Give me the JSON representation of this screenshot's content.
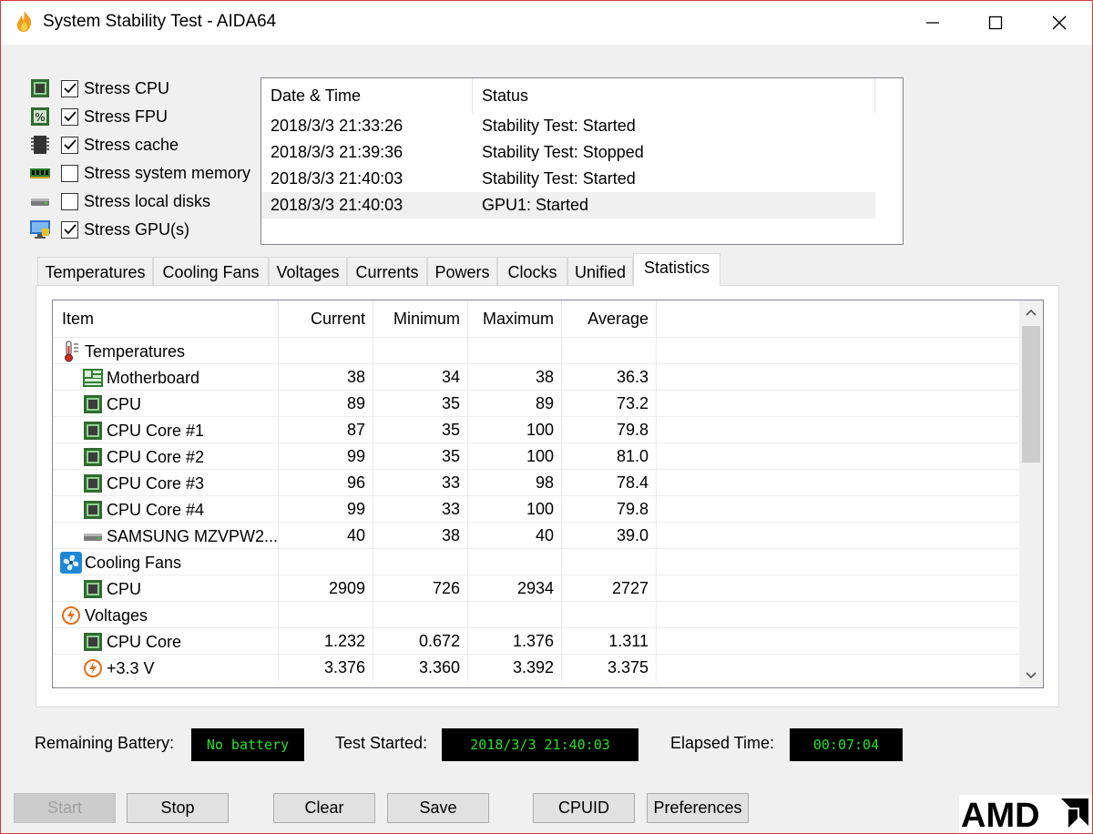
{
  "window": {
    "title": "System Stability Test - AIDA64"
  },
  "stress": [
    {
      "label": "Stress CPU",
      "checked": true,
      "icon": "cpu-chip-icon"
    },
    {
      "label": "Stress FPU",
      "checked": true,
      "icon": "fpu-percent-icon"
    },
    {
      "label": "Stress cache",
      "checked": true,
      "icon": "cache-chip-icon"
    },
    {
      "label": "Stress system memory",
      "checked": false,
      "icon": "memory-module-icon"
    },
    {
      "label": "Stress local disks",
      "checked": false,
      "icon": "disk-drive-icon"
    },
    {
      "label": "Stress GPU(s)",
      "checked": true,
      "icon": "gpu-monitor-icon"
    }
  ],
  "log": {
    "headers": [
      "Date & Time",
      "Status"
    ],
    "rows": [
      {
        "time": "2018/3/3 21:33:26",
        "status": "Stability Test: Started"
      },
      {
        "time": "2018/3/3 21:39:36",
        "status": "Stability Test: Stopped"
      },
      {
        "time": "2018/3/3 21:40:03",
        "status": "Stability Test: Started"
      },
      {
        "time": "2018/3/3 21:40:03",
        "status": "GPU1: Started"
      }
    ]
  },
  "tabs": [
    "Temperatures",
    "Cooling Fans",
    "Voltages",
    "Currents",
    "Powers",
    "Clocks",
    "Unified",
    "Statistics"
  ],
  "active_tab": "Statistics",
  "stats": {
    "headers": [
      "Item",
      "Current",
      "Minimum",
      "Maximum",
      "Average"
    ],
    "rows": [
      {
        "name": "Temperatures",
        "icon": "thermometer-icon",
        "level": 0,
        "cur": "",
        "min": "",
        "max": "",
        "avg": ""
      },
      {
        "name": "Motherboard",
        "icon": "motherboard-icon",
        "level": 1,
        "cur": "38",
        "min": "34",
        "max": "38",
        "avg": "36.3"
      },
      {
        "name": "CPU",
        "icon": "cpu-chip-icon",
        "level": 1,
        "cur": "89",
        "min": "35",
        "max": "89",
        "avg": "73.2"
      },
      {
        "name": "CPU Core #1",
        "icon": "cpu-chip-icon",
        "level": 1,
        "cur": "87",
        "min": "35",
        "max": "100",
        "avg": "79.8"
      },
      {
        "name": "CPU Core #2",
        "icon": "cpu-chip-icon",
        "level": 1,
        "cur": "99",
        "min": "35",
        "max": "100",
        "avg": "81.0"
      },
      {
        "name": "CPU Core #3",
        "icon": "cpu-chip-icon",
        "level": 1,
        "cur": "96",
        "min": "33",
        "max": "98",
        "avg": "78.4"
      },
      {
        "name": "CPU Core #4",
        "icon": "cpu-chip-icon",
        "level": 1,
        "cur": "99",
        "min": "33",
        "max": "100",
        "avg": "79.8"
      },
      {
        "name": "SAMSUNG MZVPW2...",
        "icon": "disk-drive-icon",
        "level": 1,
        "cur": "40",
        "min": "38",
        "max": "40",
        "avg": "39.0"
      },
      {
        "name": "Cooling Fans",
        "icon": "fan-icon",
        "level": 0,
        "cur": "",
        "min": "",
        "max": "",
        "avg": ""
      },
      {
        "name": "CPU",
        "icon": "cpu-chip-icon",
        "level": 1,
        "cur": "2909",
        "min": "726",
        "max": "2934",
        "avg": "2727"
      },
      {
        "name": "Voltages",
        "icon": "voltage-icon",
        "level": 0,
        "cur": "",
        "min": "",
        "max": "",
        "avg": ""
      },
      {
        "name": "CPU Core",
        "icon": "cpu-chip-icon",
        "level": 1,
        "cur": "1.232",
        "min": "0.672",
        "max": "1.376",
        "avg": "1.311"
      },
      {
        "name": "+3.3 V",
        "icon": "voltage-icon",
        "level": 1,
        "cur": "3.376",
        "min": "3.360",
        "max": "3.392",
        "avg": "3.375"
      }
    ]
  },
  "status_bar": {
    "battery_label": "Remaining Battery:",
    "battery_value": "No battery",
    "started_label": "Test Started:",
    "started_value": "2018/3/3 21:40:03",
    "elapsed_label": "Elapsed Time:",
    "elapsed_value": "00:07:04"
  },
  "buttons": {
    "start": "Start",
    "stop": "Stop",
    "clear": "Clear",
    "save": "Save",
    "cpuid": "CPUID",
    "preferences": "Preferences"
  },
  "brand": {
    "logo_text": "AMD",
    "lcd_color": "#22e22a"
  }
}
